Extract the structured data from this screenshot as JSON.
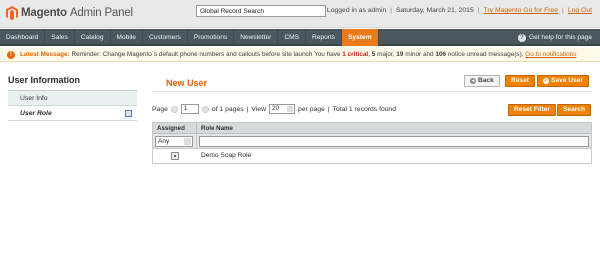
{
  "header": {
    "logo_brand": "Magento",
    "logo_suffix": "Admin Panel",
    "search_placeholder": "Global Record Search",
    "logged_in": "Logged in as admin",
    "date": "Saturday, March 21, 2015",
    "try_link": "Try Magento Go for Free",
    "logout": "Log Out"
  },
  "nav": {
    "items": [
      "Dashboard",
      "Sales",
      "Catalog",
      "Mobile",
      "Customers",
      "Promotions",
      "Newsletter",
      "CMS",
      "Reports",
      "System"
    ],
    "active": "System",
    "help": "Get help for this page"
  },
  "notice": {
    "label": "Latest Message:",
    "text": "Reminder: Change Magento`s default phone numbers and callouts before site launch",
    "you_have": "You have",
    "critical": "1 critical",
    "major_n": "5",
    "major": "major,",
    "minor_n": "19",
    "minor": "minor and",
    "notice_n": "106",
    "notice_tail": "notice unread message(s).",
    "link": "Go to notifications"
  },
  "sidebar": {
    "title": "User Information",
    "tabs": [
      "User Info",
      "User Role"
    ]
  },
  "main": {
    "title": "New User",
    "back": "Back",
    "reset": "Reset",
    "save": "Save User",
    "pager": {
      "page_label": "Page",
      "page_value": "1",
      "of_pages": "of 1 pages",
      "sep": "|",
      "view_label": "View",
      "view_value": "20",
      "per_page": "per page",
      "total": "Total 1 records found"
    },
    "reset_filter": "Reset Filter",
    "search": "Search",
    "grid": {
      "col_assigned": "Assigned",
      "col_role": "Role Name",
      "filter_any": "Any",
      "rows": [
        {
          "role": "Demo Soap Role"
        }
      ]
    }
  },
  "colors": {
    "accent": "#ec7a1b",
    "nav_bg": "#4b575f",
    "title": "#eb5e00"
  }
}
